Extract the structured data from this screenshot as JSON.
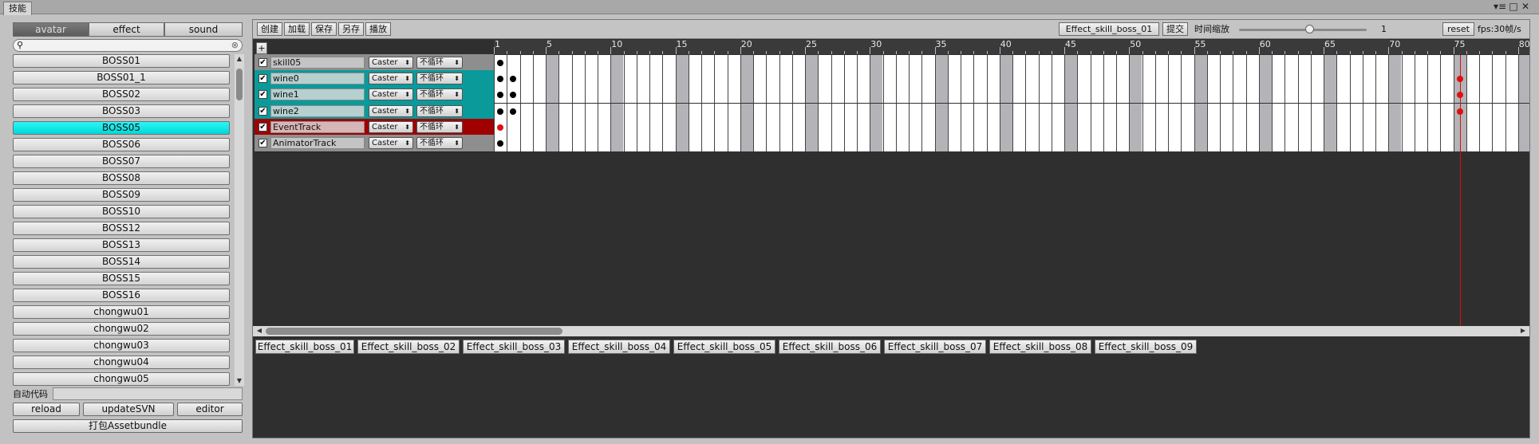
{
  "window": {
    "tab_label": "技能",
    "controls": [
      "▾≡",
      "□",
      "✕"
    ]
  },
  "left": {
    "tabs": [
      "avatar",
      "effect",
      "sound"
    ],
    "active_tab": "avatar",
    "search_value": "",
    "list_items": [
      "BOSS01",
      "BOSS01_1",
      "BOSS02",
      "BOSS03",
      "BOSS05",
      "BOSS06",
      "BOSS07",
      "BOSS08",
      "BOSS09",
      "BOSS10",
      "BOSS12",
      "BOSS13",
      "BOSS14",
      "BOSS15",
      "BOSS16",
      "chongwu01",
      "chongwu02",
      "chongwu03",
      "chongwu04",
      "chongwu05"
    ],
    "selected_item": "BOSS05",
    "auto_code_label": "自动代码",
    "auto_code_value": "",
    "buttons": {
      "reload": "reload",
      "update_svn": "updateSVN",
      "editor": "editor",
      "bundle": "打包Assetbundle"
    }
  },
  "toolbar": {
    "buttons": [
      "创建",
      "加载",
      "保存",
      "另存",
      "播放"
    ],
    "current_effect": "Effect_skill_boss_01",
    "submit": "提交",
    "time_scale_label": "时间缩放",
    "time_scale_value": "1",
    "time_scale_fraction": 0.55,
    "reset": "reset",
    "fps": "fps:30帧/s"
  },
  "timeline": {
    "add_button": "+",
    "ruler_numbers": [
      "1",
      "5",
      "10",
      "15",
      "20",
      "25",
      "30",
      "35",
      "40",
      "45",
      "50",
      "55",
      "60",
      "65",
      "70",
      "75",
      "80"
    ],
    "playhead_frame": 75,
    "tracks": [
      {
        "name": "skill05",
        "target": "Caster",
        "loop": "不循环",
        "color": "#8e8e8e",
        "name_bg": "#c4c4c4",
        "dots": [
          1
        ],
        "red_dots": []
      },
      {
        "name": "wine0",
        "target": "Caster",
        "loop": "不循环",
        "color": "#0a9a9a",
        "name_bg": "#b6cfcf",
        "dots": [
          1,
          2
        ],
        "red_dots": [
          75
        ]
      },
      {
        "name": "wine1",
        "target": "Caster",
        "loop": "不循环",
        "color": "#0a9a9a",
        "name_bg": "#b6cfcf",
        "dots": [
          1,
          2
        ],
        "red_dots": [
          75
        ]
      },
      {
        "name": "wine2",
        "target": "Caster",
        "loop": "不循环",
        "color": "#0a9a9a",
        "name_bg": "#b6cfcf",
        "dots": [
          1,
          2
        ],
        "red_dots": [
          75
        ]
      },
      {
        "name": "EventTrack",
        "target": "Caster",
        "loop": "不循环",
        "color": "#a00000",
        "name_bg": "#d6b6b6",
        "dots": [],
        "red_dots": [
          1
        ]
      },
      {
        "name": "AnimatorTrack",
        "target": "Caster",
        "loop": "不循环",
        "color": "#8e8e8e",
        "name_bg": "#c4c4c4",
        "dots": [
          1
        ],
        "red_dots": []
      }
    ]
  },
  "effect_tabs": [
    "Effect_skill_boss_01",
    "Effect_skill_boss_02",
    "Effect_skill_boss_03",
    "Effect_skill_boss_04",
    "Effect_skill_boss_05",
    "Effect_skill_boss_06",
    "Effect_skill_boss_07",
    "Effect_skill_boss_08",
    "Effect_skill_boss_09"
  ]
}
